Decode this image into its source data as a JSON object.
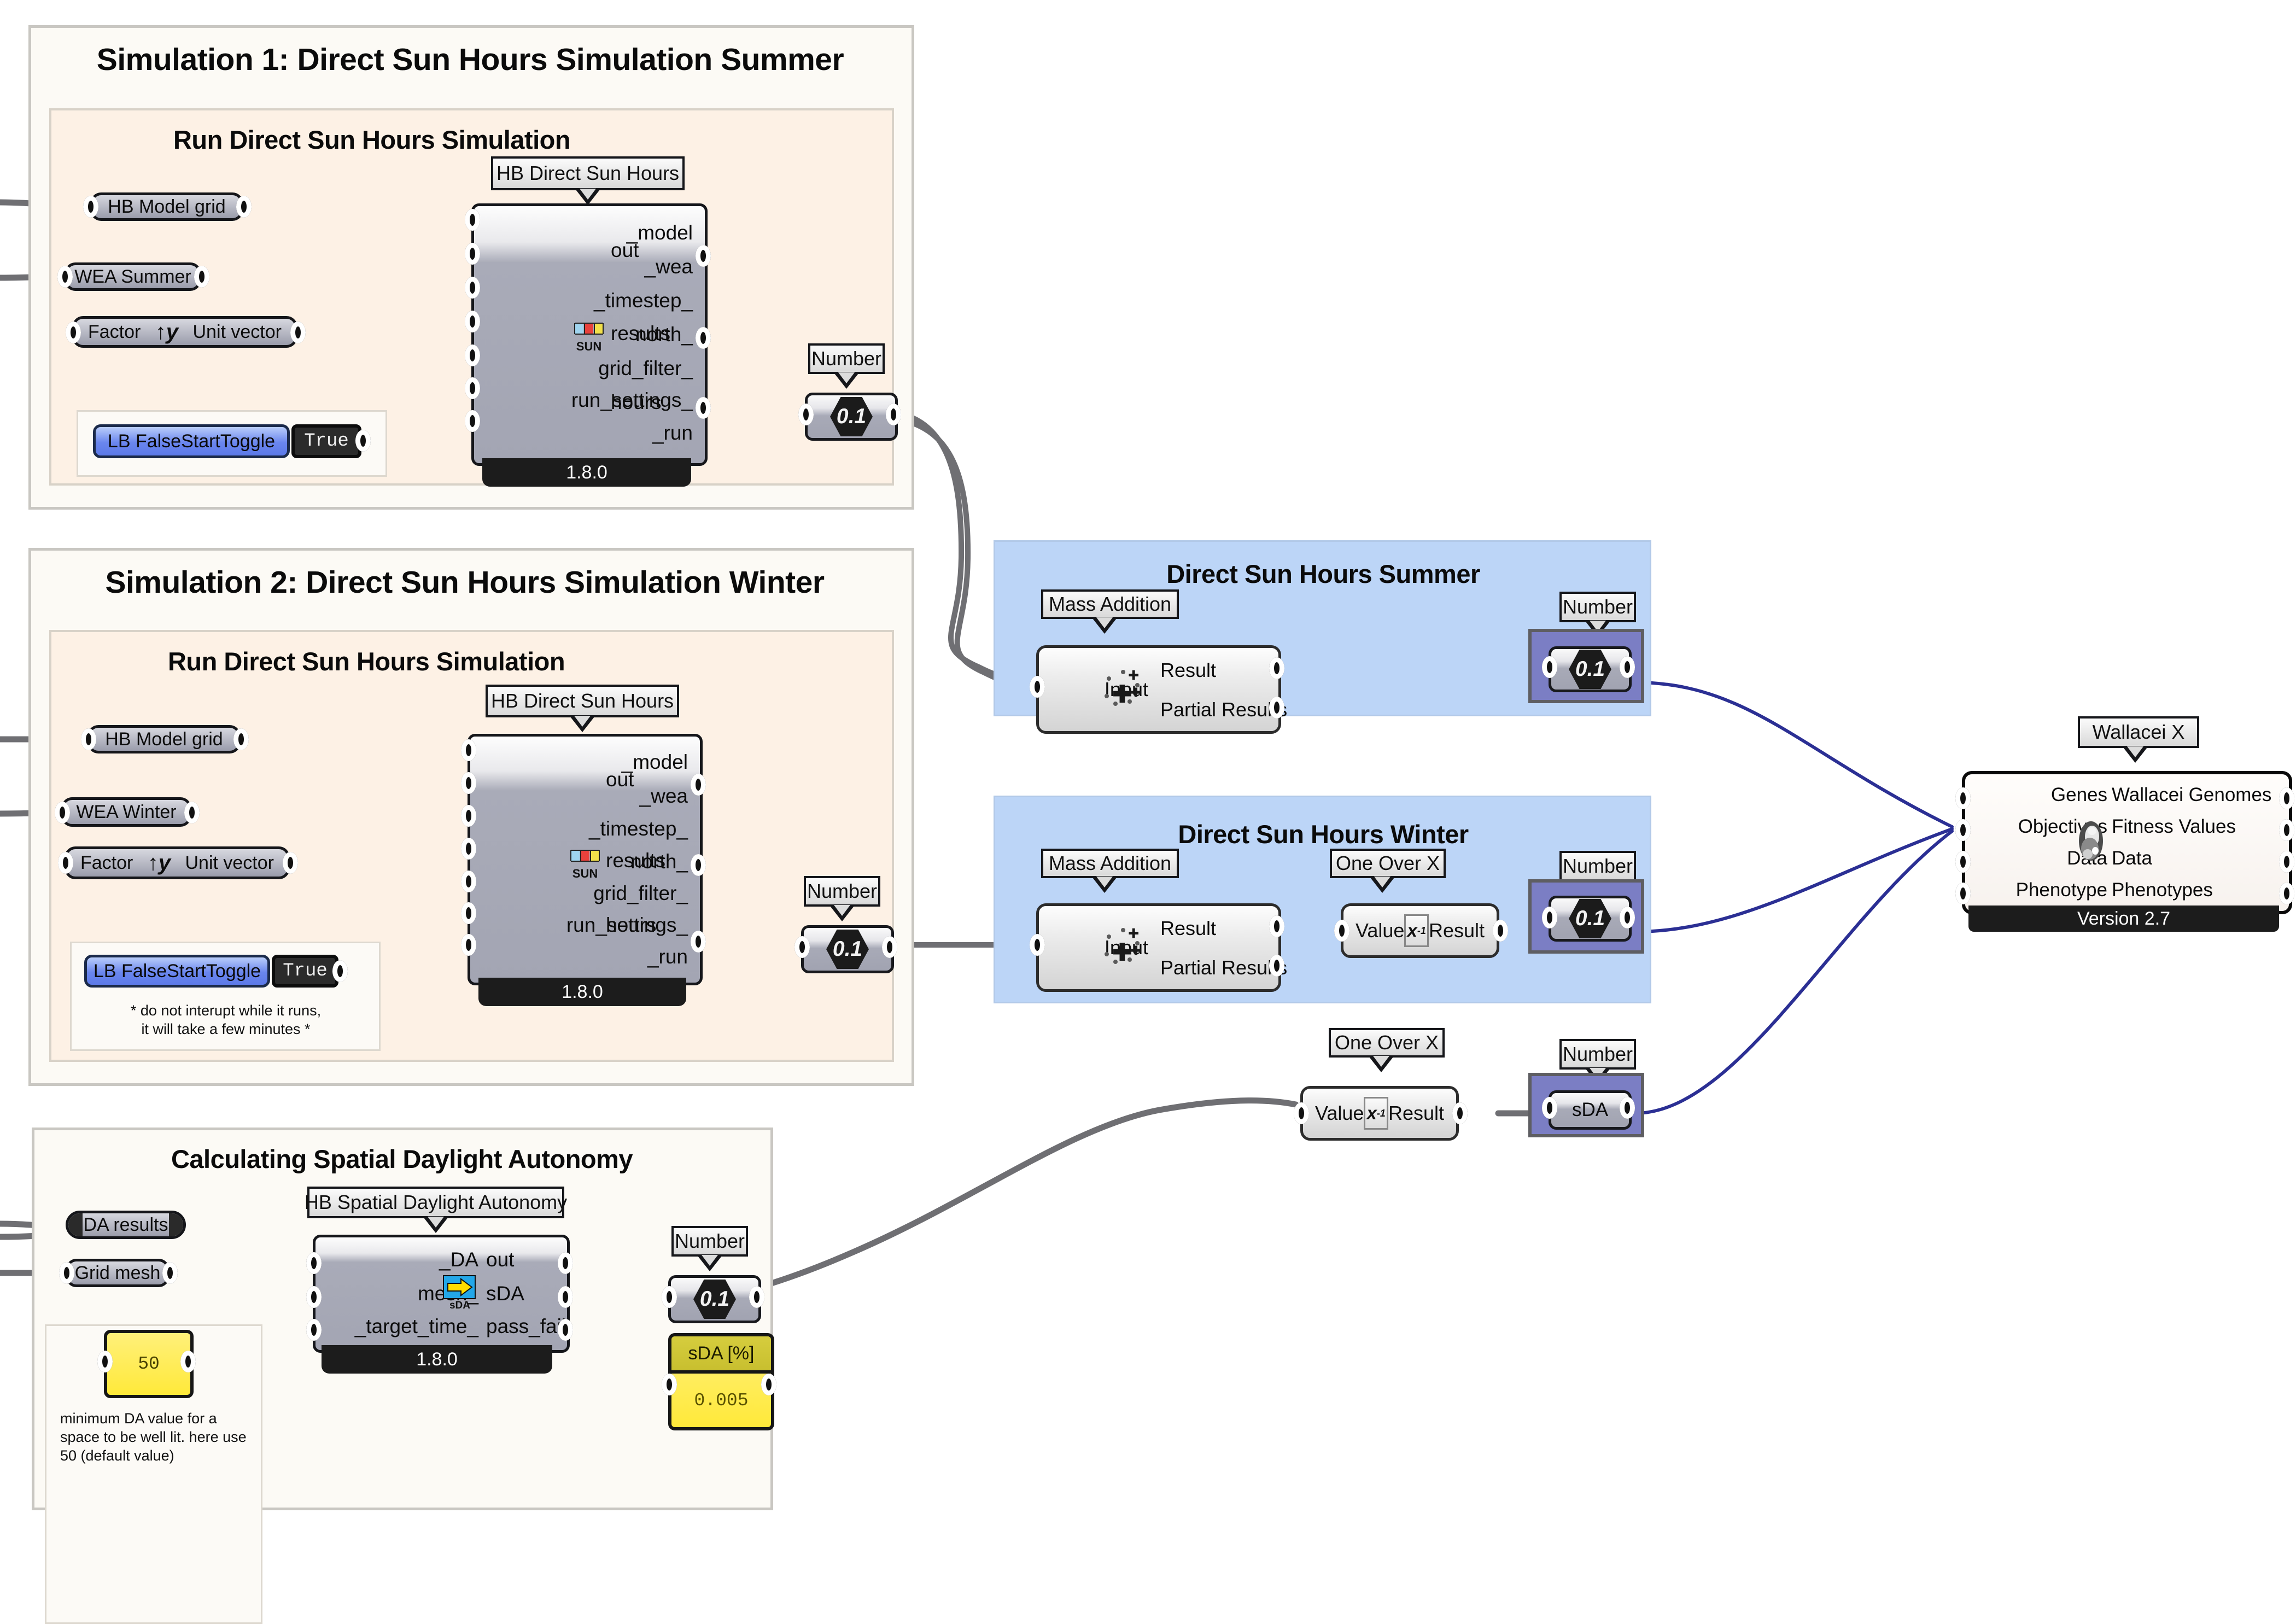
{
  "colors": {
    "group_outer_bg": "#fcfaf5",
    "group_inner_bg": "#fdf1e5",
    "group_blue_bg": "#bcd5f7",
    "group_purple_bg": "#7b7ec4",
    "wire_grey": "#6f6f73",
    "wire_blue": "#2b2f94",
    "yellow": "#ffe93a",
    "toggle_blue": "#6a86ee"
  },
  "groups": {
    "sim1": {
      "title": "Simulation 1: Direct Sun Hours Simulation Summer",
      "inner_title": "Run Direct Sun Hours Simulation"
    },
    "sim2": {
      "title": "Simulation 2: Direct Sun Hours Simulation Winter",
      "inner_title": "Run Direct Sun Hours Simulation",
      "note": "* do not interupt while it runs,\nit will take a few minutes *"
    },
    "sda": {
      "inner_title": "Calculating Spatial Daylight Autonomy",
      "note": "minimum DA value for a\nspace to be well lit. here use\n50 (default value)"
    },
    "summer_panel": {
      "title": "Direct Sun Hours Summer"
    },
    "winter_panel": {
      "title": "Direct Sun Hours Winter"
    }
  },
  "sim1": {
    "params": [
      {
        "label": "HB Model grid"
      },
      {
        "label": "WEA Summer"
      }
    ],
    "unit_vector": {
      "input": "Factor",
      "output": "Unit vector",
      "icon": "unit-y-vector-icon"
    },
    "toggle": {
      "label": "LB FalseStartToggle",
      "value": "True"
    },
    "component": {
      "nickname": "HB Direct Sun Hours",
      "inputs": [
        "_model",
        "_wea",
        "_timestep_",
        "north_",
        "grid_filter_",
        "run_settings_",
        "_run"
      ],
      "outputs": [
        "out",
        "results",
        "hours"
      ],
      "version": "1.8.0",
      "icon": "sun-icon"
    },
    "number": {
      "nickname": "Number",
      "value": "0.1"
    }
  },
  "sim2": {
    "params": [
      {
        "label": "HB Model grid"
      },
      {
        "label": "WEA Winter"
      }
    ],
    "unit_vector": {
      "input": "Factor",
      "output": "Unit vector",
      "icon": "unit-y-vector-icon"
    },
    "toggle": {
      "label": "LB FalseStartToggle",
      "value": "True"
    },
    "component": {
      "nickname": "HB Direct Sun Hours",
      "inputs": [
        "_model",
        "_wea",
        "_timestep_",
        "north_",
        "grid_filter_",
        "run_settings_",
        "_run"
      ],
      "outputs": [
        "out",
        "results",
        "hours"
      ],
      "version": "1.8.0",
      "icon": "sun-icon"
    },
    "number": {
      "nickname": "Number",
      "value": "0.1"
    }
  },
  "sda": {
    "params": [
      {
        "label": "DA results",
        "selected": true
      },
      {
        "label": "Grid mesh",
        "selected": false
      }
    ],
    "target_time": {
      "value": "50"
    },
    "component": {
      "nickname": "HB Spatial Daylight Autonomy",
      "inputs": [
        "_DA",
        "mesh_",
        "_target_time_"
      ],
      "outputs": [
        "out",
        "sDA",
        "pass_fail"
      ],
      "version": "1.8.0",
      "icon": "sda-icon"
    },
    "number": {
      "nickname": "Number",
      "value": "0.1"
    },
    "result_panel": {
      "header": "sDA [%]",
      "value": "0.005"
    }
  },
  "summer_panel": {
    "mass_addition": {
      "nickname": "Mass Addition",
      "input": "Input",
      "outputs": [
        "Result",
        "Partial Results"
      ],
      "icon": "mass-addition-icon"
    },
    "number": {
      "nickname": "Number",
      "value": "0.1"
    }
  },
  "winter_panel": {
    "mass_addition": {
      "nickname": "Mass Addition",
      "input": "Input",
      "outputs": [
        "Result",
        "Partial Results"
      ],
      "icon": "mass-addition-icon"
    },
    "one_over_x": {
      "nickname": "One Over X",
      "input": "Value",
      "output": "Result",
      "icon": "x-inverse-icon"
    },
    "number": {
      "nickname": "Number",
      "value": "0.1"
    }
  },
  "sda_inverse": {
    "one_over_x": {
      "nickname": "One Over X",
      "input": "Value",
      "output": "Result",
      "icon": "x-inverse-icon"
    },
    "number": {
      "nickname": "Number",
      "label": "sDA"
    }
  },
  "wallacei": {
    "nickname": "Wallacei X",
    "inputs": [
      "Genes",
      "Objectives",
      "Data",
      "Phenotype"
    ],
    "outputs": [
      "Wallacei Genomes",
      "Fitness Values",
      "Data",
      "Phenotypes"
    ],
    "version": "Version 2.7",
    "icon": "darwin-portrait-icon"
  }
}
